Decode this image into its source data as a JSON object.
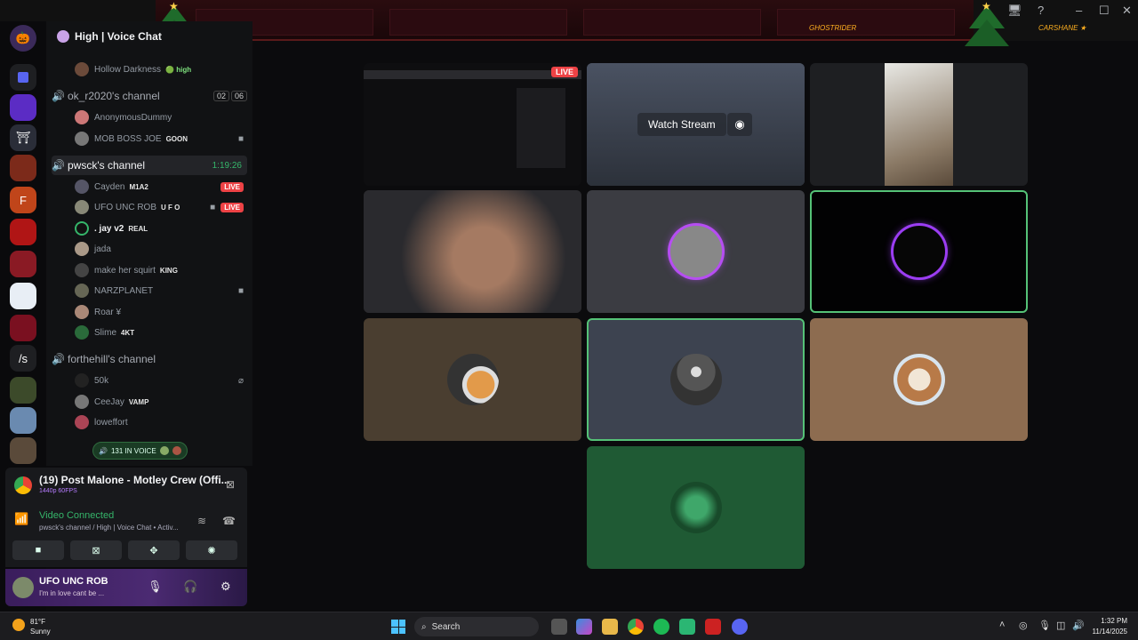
{
  "topbar": {
    "names": [
      "GHOSTRIDER",
      "CARSHANE ★"
    ],
    "window_controls": [
      "🖥",
      "?",
      "–",
      "☐",
      "✕"
    ]
  },
  "server": {
    "name": "High | Voice Chat"
  },
  "rail": {
    "text_server": "/s"
  },
  "channels": [
    {
      "name": "",
      "counts": [],
      "users": [
        {
          "name": "Hollow Darkness",
          "tag": "🟢 high",
          "live": "",
          "cam": false
        }
      ]
    },
    {
      "name": "ok_r2020's channel",
      "counts": [
        "02",
        "06"
      ],
      "users": [
        {
          "name": "AnonymousDummy",
          "tag": "",
          "live": "",
          "cam": false
        },
        {
          "name": "MOB BOSS JOE",
          "tag": "GOON",
          "live": "",
          "cam": true
        }
      ]
    },
    {
      "name": "pwsck's channel",
      "timer": "1:19:26",
      "active": true,
      "users": [
        {
          "name": "Cayden",
          "tag": "M1A2",
          "live": "LIVE",
          "cam": false
        },
        {
          "name": "UFO UNC ROB",
          "tag": "U F O",
          "live": "LIVE",
          "cam": true
        },
        {
          "name": ". jay v2",
          "tag": "REAL",
          "live": "",
          "cam": false
        },
        {
          "name": "jada",
          "tag": "",
          "live": "",
          "cam": false
        },
        {
          "name": "make her squirt",
          "tag": "KING",
          "live": "",
          "cam": false
        },
        {
          "name": "NARZPLANET",
          "tag": "",
          "live": "",
          "cam": true
        },
        {
          "name": "Roar ¥",
          "tag": "",
          "live": "",
          "cam": false
        },
        {
          "name": "Slime",
          "tag": "4KT",
          "live": "",
          "cam": false
        }
      ]
    },
    {
      "name": "forthehill's channel",
      "counts": [],
      "users": [
        {
          "name": "50k",
          "tag": "",
          "live": "",
          "cam": false
        },
        {
          "name": "CeeJay",
          "tag": "VAMP",
          "live": "",
          "cam": false
        },
        {
          "name": "loweffort",
          "tag": "",
          "live": "",
          "cam": false
        }
      ]
    }
  ],
  "voice_pill": "131 IN VOICE",
  "media": {
    "title": "(19) Post Malone - Motley Crew (Offi...",
    "quality": "1440p 60FPS"
  },
  "voice_connection": {
    "status": "Video Connected",
    "detail": "pwsck's channel / High | Voice Chat • Activ...",
    "buttons": [
      "camera-button",
      "screen-share-button",
      "activities-button",
      "soundboard-button"
    ]
  },
  "user": {
    "name": "UFO UNC ROB",
    "status": "I'm in love cant be ..."
  },
  "stage": {
    "live_label": "LIVE",
    "watch_label": "Watch Stream",
    "tiles": [
      {
        "id": "stream-youtube",
        "bg": "#0e0e10"
      },
      {
        "id": "stream-game",
        "bg": "#3a3f4a"
      },
      {
        "id": "cam-ceiling",
        "bg": "#1e1f22"
      },
      {
        "id": "cam-person",
        "bg": "#222"
      },
      {
        "id": "avatar-sticker",
        "bg": "#3b3c42"
      },
      {
        "id": "avatar-dark",
        "bg": "#020203"
      },
      {
        "id": "avatar-cat",
        "bg": "#4a3e30"
      },
      {
        "id": "avatar-person",
        "bg": "#3d4350"
      },
      {
        "id": "avatar-dog",
        "bg": "#8d6c50"
      },
      {
        "id": "avatar-green",
        "bg": "#1f5a34"
      }
    ]
  },
  "taskbar": {
    "weather_temp": "81°F",
    "weather_desc": "Sunny",
    "search_label": "Search",
    "time": "1:32 PM",
    "date": "11/14/2025"
  }
}
